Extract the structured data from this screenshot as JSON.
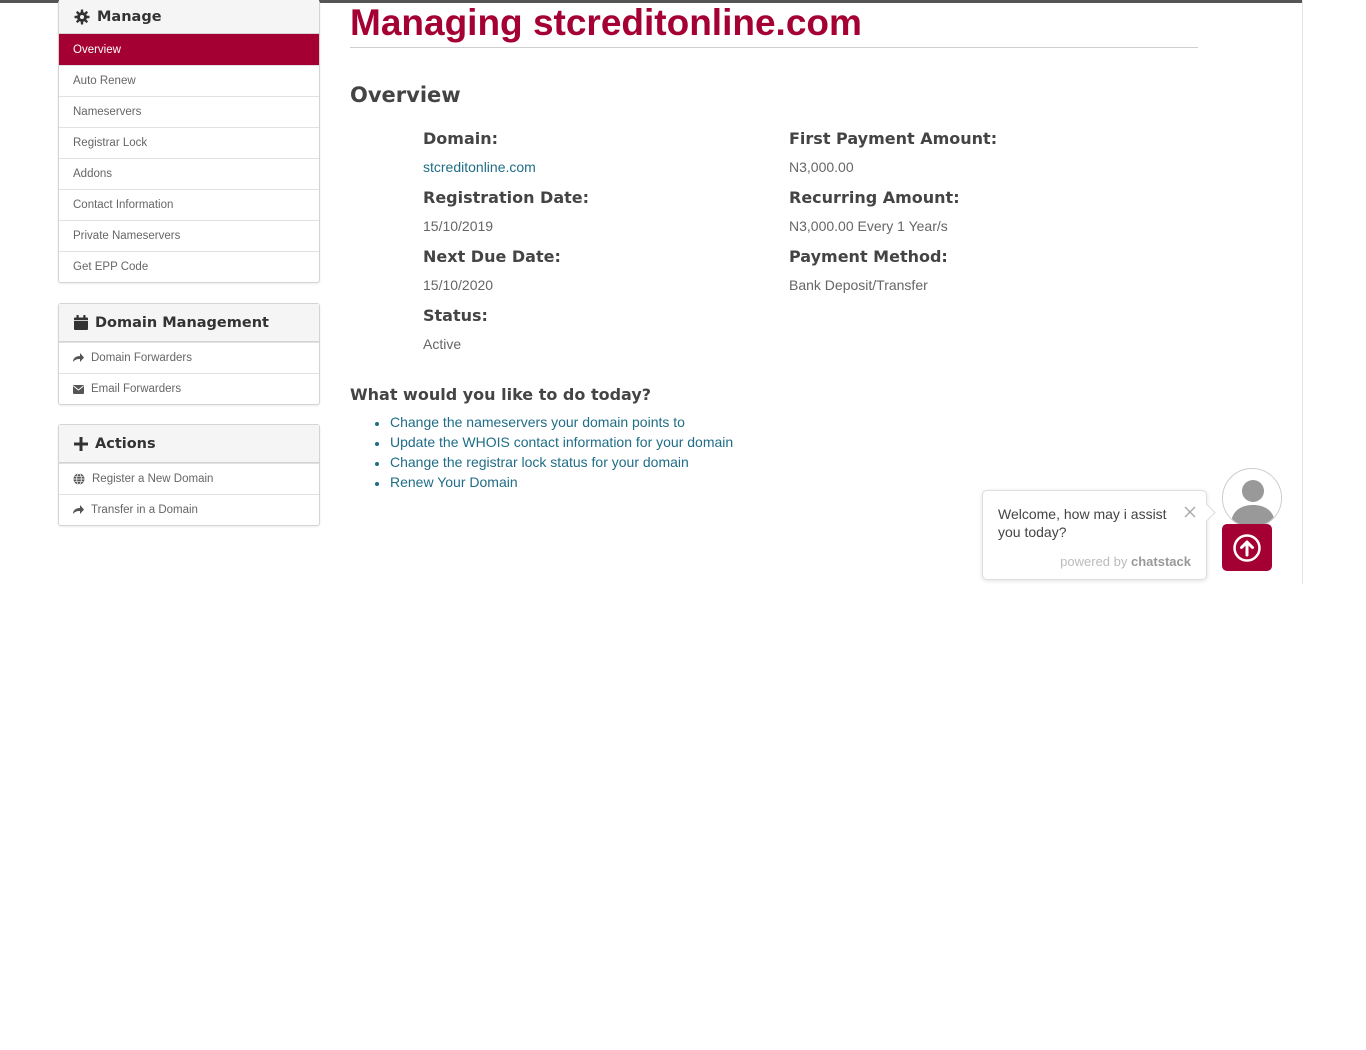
{
  "sidebar": {
    "manage": {
      "title": "Manage",
      "items": [
        "Overview",
        "Auto Renew",
        "Nameservers",
        "Registrar Lock",
        "Addons",
        "Contact Information",
        "Private Nameservers",
        "Get EPP Code"
      ]
    },
    "domain_management": {
      "title": "Domain Management",
      "items": [
        "Domain Forwarders",
        "Email Forwarders"
      ]
    },
    "actions": {
      "title": "Actions",
      "items": [
        "Register a New Domain",
        "Transfer in a Domain"
      ]
    }
  },
  "main": {
    "title": "Managing stcreditonline.com",
    "section_title": "Overview",
    "details": {
      "domain_label": "Domain:",
      "domain_value": "stcreditonline.com",
      "registration_label": "Registration Date:",
      "registration_value": "15/10/2019",
      "next_due_label": "Next Due Date:",
      "next_due_value": "15/10/2020",
      "status_label": "Status:",
      "status_value": "Active",
      "first_payment_label": "First Payment Amount:",
      "first_payment_value": "N3,000.00",
      "recurring_label": "Recurring Amount:",
      "recurring_value": "N3,000.00 Every 1 Year/s",
      "payment_method_label": "Payment Method:",
      "payment_method_value": "Bank Deposit/Transfer"
    },
    "todo_title": "What would you like to do today?",
    "todo_links": [
      "Change the nameservers your domain points to",
      "Update the WHOIS contact information for your domain",
      "Change the registrar lock status for your domain",
      "Renew Your Domain"
    ]
  },
  "chat": {
    "message": "Welcome, how may i assist you today?",
    "powered_prefix": "powered by",
    "powered_brand": "chatstack"
  },
  "colors": {
    "accent": "#a50034",
    "link": "#1f6d86"
  },
  "icons": [
    "gear-icon",
    "calendar-icon",
    "plus-icon",
    "share-icon",
    "envelope-icon",
    "globe-icon",
    "close-icon",
    "arrow-up-icon",
    "avatar-icon"
  ]
}
